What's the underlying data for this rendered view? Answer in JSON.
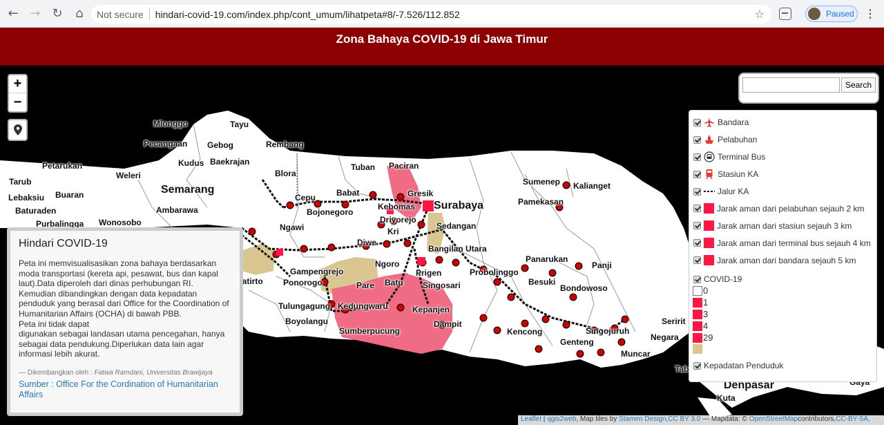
{
  "browser": {
    "security": "Not secure",
    "url": "hindari-covid-19.com/index.php/cont_umum/lihatpeta#8/-7.526/112.852",
    "profile_status": "Paused"
  },
  "header": {
    "title": "Zona Bahaya COVID-19 di Jawa Timur"
  },
  "zoom": {
    "in": "+",
    "out": "−"
  },
  "search": {
    "placeholder": "",
    "button": "Search"
  },
  "cities": {
    "mlonggo": "Mlonggo",
    "tayu": "Tayu",
    "pecangaan": "Pecangaan",
    "gebog": "Gebog",
    "rembang": "Rembang",
    "kudus": "Kudus",
    "baekrajan": "Baekrajan",
    "petarukan": "Petarukan",
    "weleri": "Weleri",
    "semarang": "Semarang",
    "tarub": "Tarub",
    "buaran": "Buaran",
    "lebaksiu": "Lebaksiu",
    "ambarawa": "Ambarawa",
    "baturaden": "Baturaden",
    "purbalingga": "Purbalingga",
    "wonosobo": "Wonosobo",
    "blora": "Blora",
    "tuban": "Tuban",
    "paciran": "Paciran",
    "gresik": "Gresik",
    "surabaya": "Surabaya",
    "babat": "Babat",
    "cepu": "Cepu",
    "bojonegoro": "Bojonegoro",
    "kebomas": "Kebomas",
    "driyorejo": "Driyorejo",
    "sedangan": "Sedangan",
    "ngawi": "Ngawi",
    "krian": "Kri",
    "diwek": "Diwe",
    "bangilutara": "Bangilan Utara",
    "ngoro": "Ngoro",
    "gampengrejo": "Gampengrejo",
    "pare": "Pare",
    "batu": "Batu",
    "pujon": "Prigen",
    "singosari": "Singosari",
    "probolinggo": "Probolinggo",
    "ponorogo": "Ponorogo",
    "batirto": "Batirto",
    "tulungagung": "Tulungagung",
    "kedungwaru": "Kedungwaru",
    "kepanjen": "Kepanjen",
    "boyolangu": "Boyolangu",
    "dampit": "Dampit",
    "sumberpucung": "Sumberpucung",
    "sumenep": "Sumenep",
    "kalianget": "Kalianget",
    "pamekasan": "Pamekasan",
    "panarukan": "Panarukan",
    "panji": "Panji",
    "besuki": "Besuki",
    "bondowoso": "Bondowoso",
    "kencong": "Kencong",
    "singojuruh": "Singojuruh",
    "genteng": "Genteng",
    "muncar": "Muncar",
    "seririt": "Seririt",
    "negara": "Negara",
    "tabanan": "Tab",
    "denpasar": "Denpasar",
    "kuta": "Kuta",
    "gianyar": "Gaya"
  },
  "layers": {
    "items": [
      "Bandara",
      "Pelabuhan",
      "Terminal Bus",
      "Stasiun KA",
      "Jalur KA",
      "Jarak aman dari pelabuhan sejauh 2 km",
      "Jarak aman dari stasiun sejauh 3 km",
      "Jarak aman dari terminal bus sejauh 4 km",
      "Jarak aman dari bandara sejauh 5 km",
      "COVID-19"
    ],
    "covid_legend": [
      "0",
      "1",
      "3",
      "4",
      "29",
      ""
    ],
    "density": "Kepadatan Penduduk",
    "colors": {
      "zone": "#ff1744",
      "covid_high": "#f06c84",
      "density": "#d9c690",
      "accent": "#8b0000"
    }
  },
  "info": {
    "title": "Hindari COVID-19",
    "body": "Peta ini memvisualisasikan zona bahaya berdasarkan moda transportasi (kereta api, pesawat, bus dan kapal laut).Data diperoleh dari dinas perhubungan RI. Kemudian dibandingkan dengan data kepadatan penduduk yang berasal dari Office for the Coordination of Humanitarian Affairs (OCHA) di bawah PBB.",
    "body2": "Peta ini tidak dapat",
    "body3": "digunakan sebagai landasan utama pencegahan, hanya sebagai data pendukung.Diperlukan data lain agar informasi lebih akurat.",
    "dev_label": "— Dikembangkan oleh : ",
    "dev_name": "Fatwa Ramdani, Universitas Brawijaya",
    "source": "Sumber : Office For the Cordination of Humanitarian Affairs"
  },
  "attribution": {
    "leaflet": "Leaflet",
    "sep1": " | ",
    "qgis": "qgis2web",
    "tiles": ", Map tiles by ",
    "stamen": "Stamen Design",
    "cc": ",CC BY 3.0",
    "mapdata": " — Mapdata: © ",
    "osm": "OpenStreetMap",
    "contrib": "contributors,",
    "ccbysa": "CC-BY-SA,"
  }
}
